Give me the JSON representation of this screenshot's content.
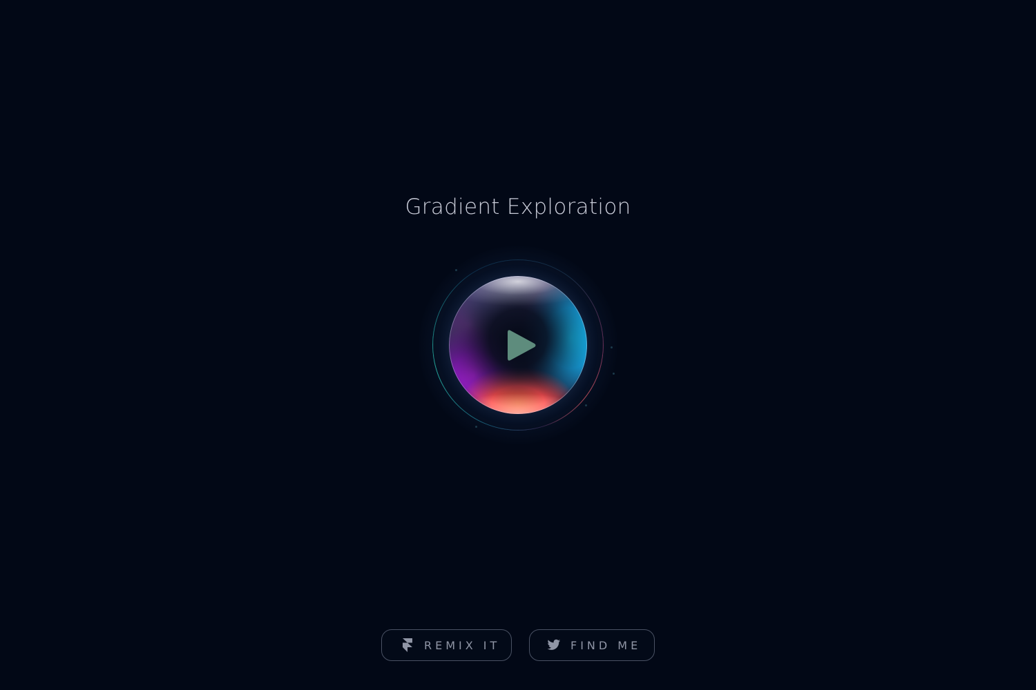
{
  "header": {
    "title": "Gradient Exploration"
  },
  "player": {
    "play_icon": "play-icon",
    "accent_colors": {
      "orange": "#ff6a3a",
      "magenta": "#a020c8",
      "cyan": "#16b8e8",
      "teal": "#2dd4bf",
      "play": "#5e8c7d"
    }
  },
  "footer": {
    "remix_label": "REMIX IT",
    "remix_icon": "framer-icon",
    "find_label": "FIND ME",
    "find_icon": "twitter-icon"
  },
  "theme": {
    "background": "#020816",
    "title_color": "#c9ccd8",
    "button_border": "#4a5264",
    "button_text": "#9096a6"
  }
}
